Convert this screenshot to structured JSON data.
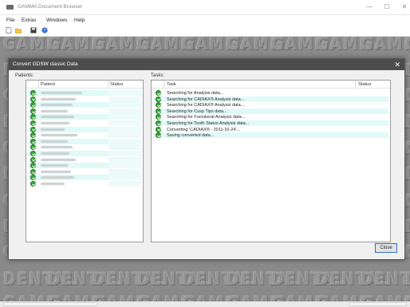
{
  "window": {
    "title": "GAMMA Document Browser",
    "minimize_glyph": "—",
    "maximize_glyph": "☐",
    "close_glyph": "✕"
  },
  "menu": [
    "File",
    "Extras",
    "Windows",
    "Help"
  ],
  "toolbar": {
    "icons": [
      "new-document-icon",
      "open-folder-icon",
      "save-icon",
      "help-icon"
    ]
  },
  "watermark": {
    "text": "GAMMA",
    "text_secondary": "DENTAL"
  },
  "dialog": {
    "title": "Convert GDSW classic Data",
    "close_glyph": "✕",
    "patients_label": "Patients:",
    "tasks_label": "Tasks:",
    "patients_columns": [
      "Patient",
      "Status"
    ],
    "tasks_columns": [
      "Task",
      "Status"
    ],
    "patient_count": 16,
    "tasks": [
      "Searching for Analysis data...",
      "Searching for CADIAX® Analysis data...",
      "Searching for CADIAX® Analysis data...",
      "Searching for Cusp Tips data...",
      "Searching for Functional Analysis data...",
      "Searching for Tooth Status Analysis data...",
      "Converting 'CADIAX® - 2011-10-24'...",
      "Saving converted data..."
    ],
    "close_button": "Close"
  },
  "colors": {
    "dialog_title_bg": "#4d4d4d",
    "row_highlight": "#e0faf7",
    "check_green": "#39a63a",
    "workspace_bg": "#8a8a8a",
    "button_focus": "#2f6fd1"
  }
}
